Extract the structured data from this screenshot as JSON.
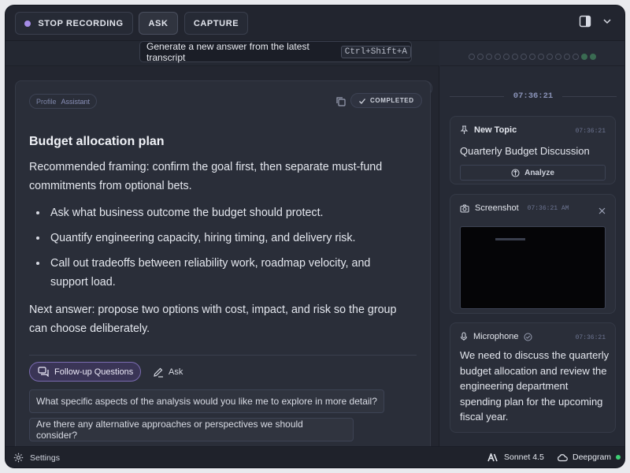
{
  "toolbar": {
    "stop_label": "STOP RECORDING",
    "ask_label": "ASK",
    "capture_label": "CAPTURE",
    "accent_color": "#a58ce6"
  },
  "tooltip": {
    "text": "Generate a new answer from the latest transcript",
    "shortcut": "Ctrl+Shift+A"
  },
  "ghost_badge": "istant",
  "answer": {
    "profile_label": "Profile",
    "profile_value": "Assistant",
    "status": "COMPLETED",
    "title": "Budget allocation plan",
    "intro": "Recommended framing: confirm the goal first, then separate must-fund commitments from optional bets.",
    "bullets": [
      "Ask what business outcome the budget should protect.",
      "Quantify engineering capacity, hiring timing, and delivery risk.",
      "Call out tradeoffs between reliability work, roadmap velocity, and support load."
    ],
    "next": "Next answer: propose two options with cost, impact, and risk so the group can choose deliberately.",
    "followup_label": "Follow-up Questions",
    "ask_label": "Ask",
    "questions": [
      "What specific aspects of the analysis would you like me to explore in more detail?",
      "Are there any alternative approaches or perspectives we should consider?",
      ""
    ]
  },
  "timeline": {
    "time": "07:36:21",
    "topic": {
      "header": "New Topic",
      "time": "07:36:21",
      "title": "Quarterly Budget Discussion",
      "analyze_label": "Analyze"
    },
    "screenshot": {
      "header": "Screenshot",
      "time": "07:36:21 AM"
    },
    "microphone": {
      "header": "Microphone",
      "time": "07:36:21",
      "text": "We need to discuss the quarterly budget allocation and review the engineering department spending plan for the upcoming fiscal year."
    }
  },
  "footer": {
    "settings_label": "Settings",
    "model_label": "Sonnet 4.5",
    "stt_label": "Deepgram",
    "status_color": "#3ecf74"
  }
}
